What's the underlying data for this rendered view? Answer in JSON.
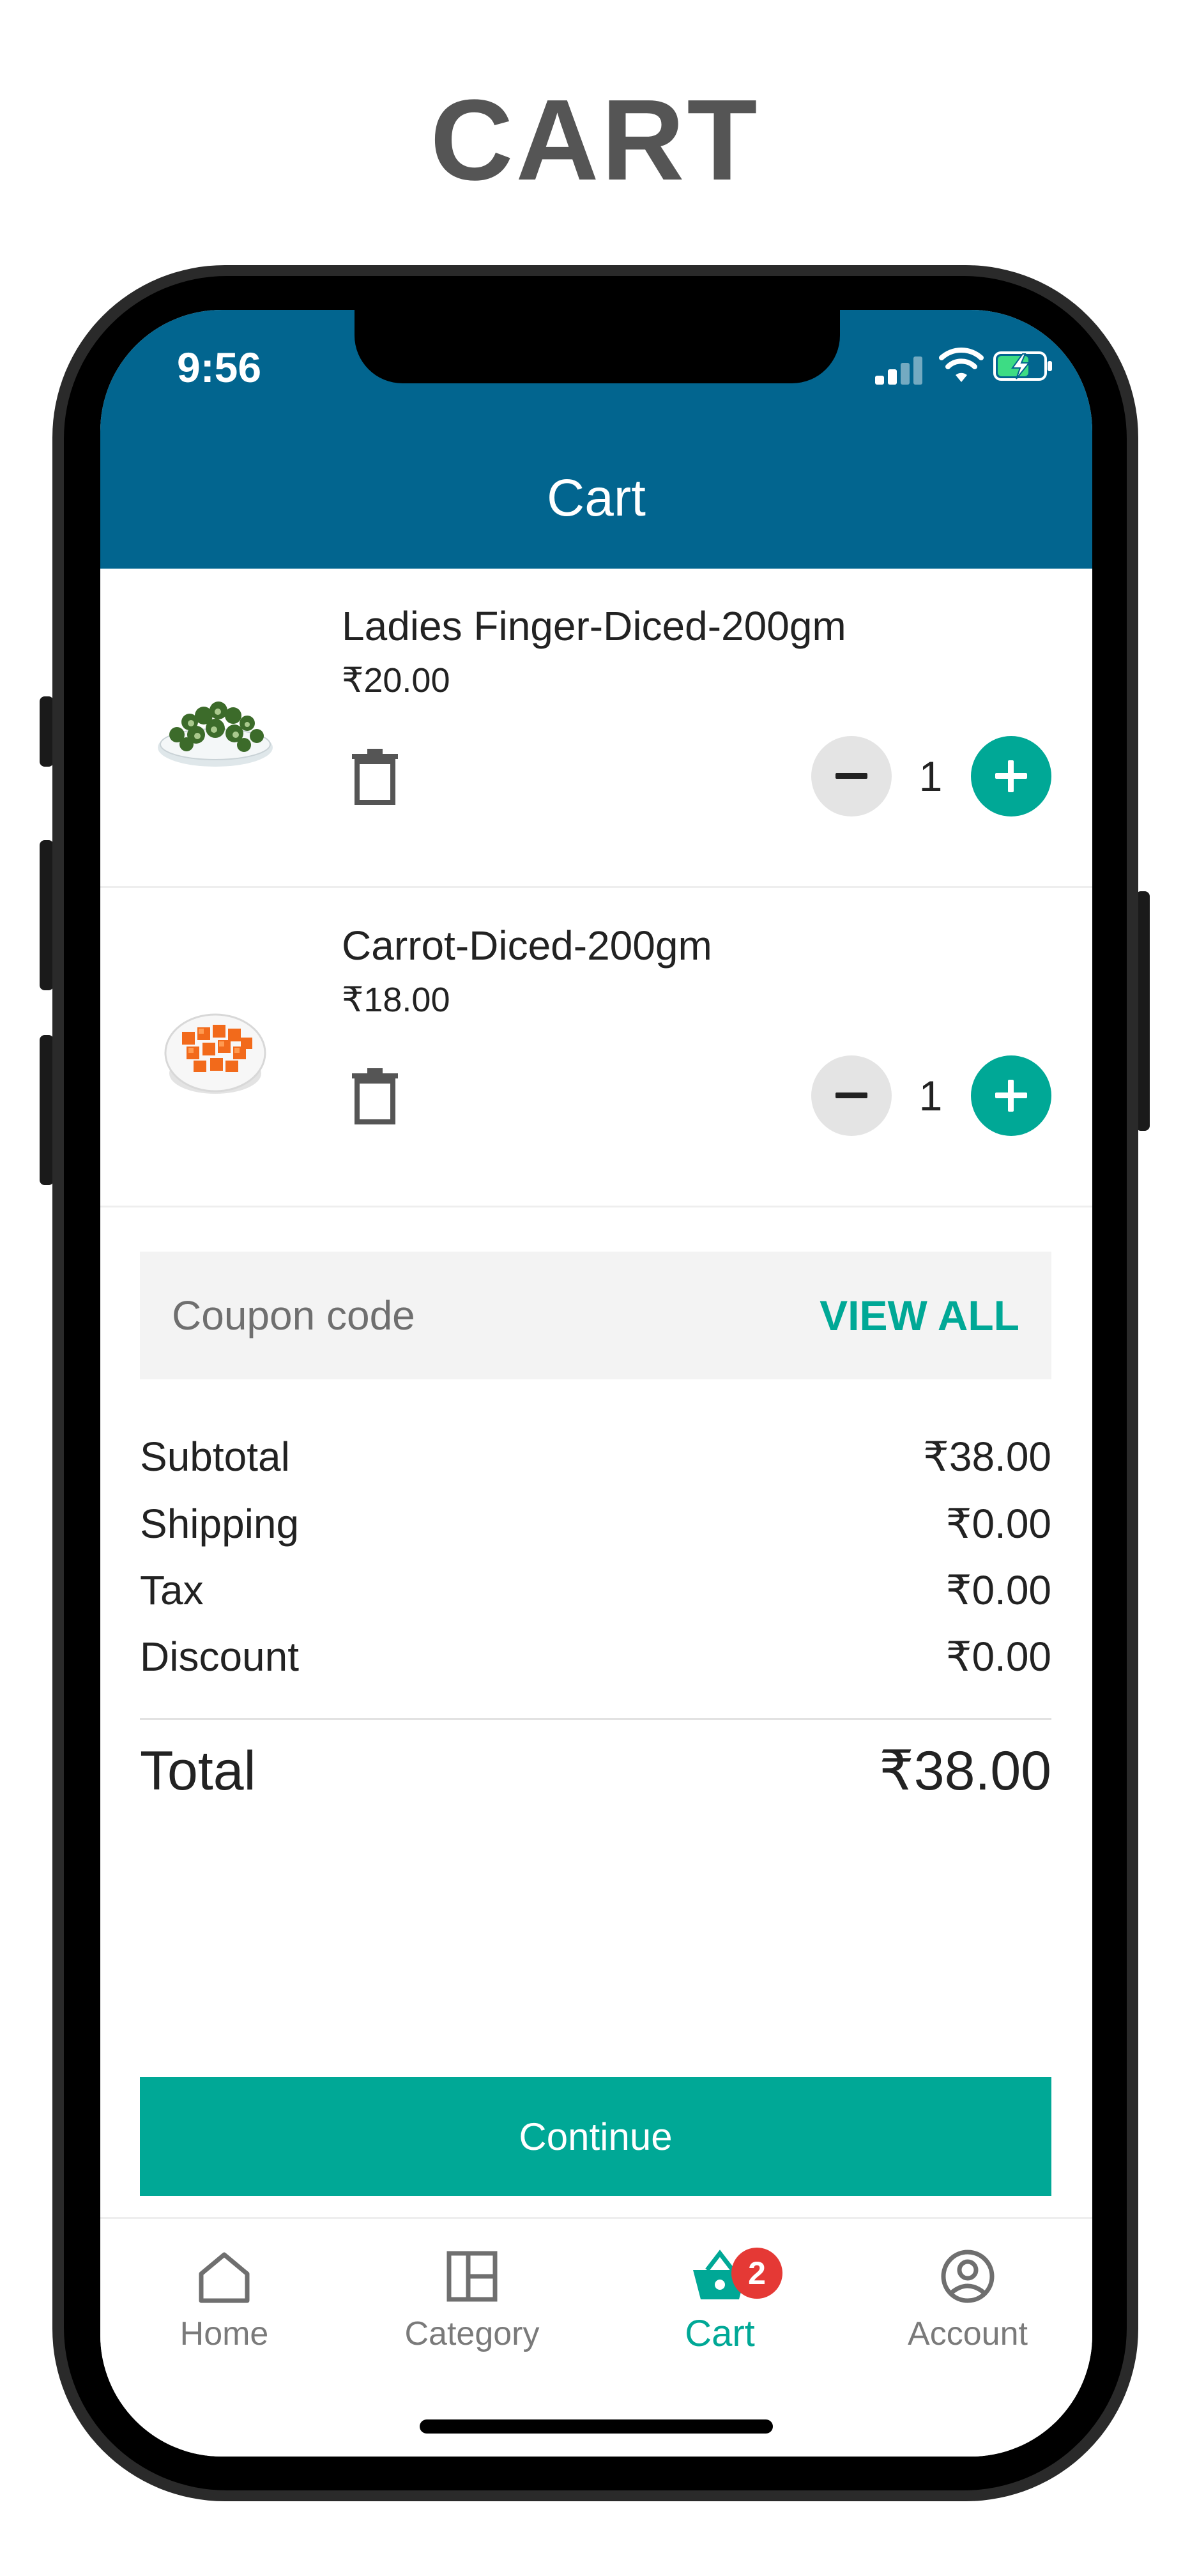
{
  "page": {
    "heading": "CART"
  },
  "status_bar": {
    "time": "9:56",
    "icons": [
      "cellular-signal-icon",
      "wifi-icon",
      "battery-charging-icon"
    ]
  },
  "app_bar": {
    "title": "Cart"
  },
  "cart": {
    "items": [
      {
        "name": "Ladies Finger-Diced-200gm",
        "price": "₹20.00",
        "quantity": "1",
        "thumbnail_icon": "diced-okra-bowl-image"
      },
      {
        "name": "Carrot-Diced-200gm",
        "price": "₹18.00",
        "quantity": "1",
        "thumbnail_icon": "diced-carrot-bowl-image"
      }
    ]
  },
  "coupon": {
    "placeholder": "Coupon code",
    "view_all_label": "VIEW ALL"
  },
  "summary": {
    "rows": [
      {
        "label": "Subtotal",
        "value": "₹38.00"
      },
      {
        "label": "Shipping",
        "value": "₹0.00"
      },
      {
        "label": "Tax",
        "value": "₹0.00"
      },
      {
        "label": "Discount",
        "value": "₹0.00"
      }
    ],
    "total": {
      "label": "Total",
      "value": "₹38.00"
    }
  },
  "continue_label": "Continue",
  "bottom_nav": {
    "items": [
      {
        "label": "Home",
        "icon": "home-icon",
        "active": false
      },
      {
        "label": "Category",
        "icon": "category-grid-icon",
        "active": false
      },
      {
        "label": "Cart",
        "icon": "cart-basket-icon",
        "active": true,
        "badge": "2"
      },
      {
        "label": "Account",
        "icon": "account-circle-icon",
        "active": false
      }
    ]
  },
  "colors": {
    "app_bar": "#02658f",
    "accent": "#00a896",
    "badge": "#e53935",
    "heading_text": "#555555",
    "coupon_bg": "#f3f3f3"
  }
}
